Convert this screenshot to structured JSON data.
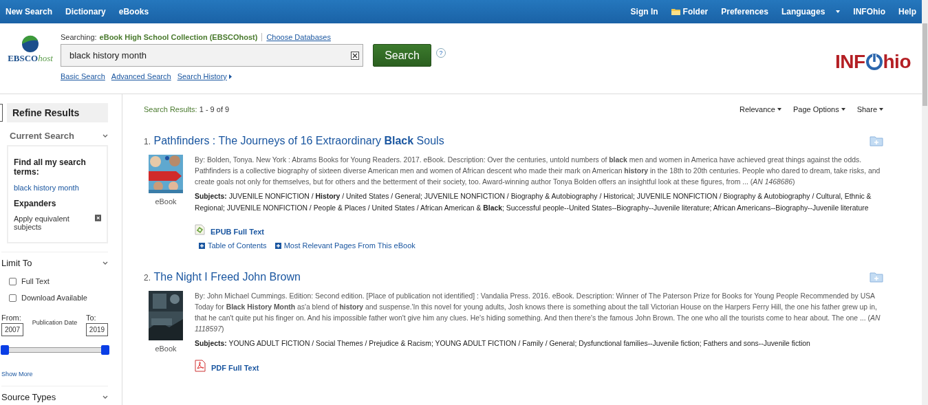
{
  "topbar": {
    "left": [
      "New Search",
      "Dictionary",
      "eBooks"
    ],
    "right": [
      {
        "label": "Sign In",
        "kind": "link"
      },
      {
        "label": "Folder",
        "kind": "folder"
      },
      {
        "label": "Preferences",
        "kind": "link"
      },
      {
        "label": "Languages",
        "kind": "dropdown"
      },
      {
        "label": "INFOhio",
        "kind": "link"
      },
      {
        "label": "Help",
        "kind": "link"
      }
    ]
  },
  "header": {
    "logo": {
      "main": "EBSCO",
      "suffix": "host"
    },
    "searching_label": "Searching:",
    "database": "eBook High School Collection (EBSCOhost)",
    "choose_link": "Choose Databases",
    "query": "black history month",
    "search_button": "Search",
    "help": "?",
    "links": [
      {
        "label": "Basic Search",
        "arrow": false
      },
      {
        "label": "Advanced Search",
        "arrow": false
      },
      {
        "label": "Search History",
        "arrow": true
      }
    ],
    "brand": {
      "left": "INF",
      "right": "hio"
    }
  },
  "sidebar": {
    "title": "Refine Results",
    "current_search": {
      "heading": "Current Search",
      "expanded": true,
      "find_label": "Find all my search terms:",
      "terms": "black history month",
      "expanders_label": "Expanders",
      "expander": "Apply equivalent subjects"
    },
    "limit_to": {
      "heading": "Limit To",
      "expanded": true,
      "options": [
        {
          "label": "Full Text",
          "checked": false
        },
        {
          "label": "Download Available",
          "checked": false
        }
      ],
      "from_label": "From:",
      "to_label": "To:",
      "from": "2007",
      "to": "2019",
      "date_label": "Publication Date",
      "slider": {
        "level": 1
      },
      "show_more": "Show More"
    },
    "source_types": {
      "heading": "Source Types",
      "expanded": true
    }
  },
  "results": {
    "label": "Search Results:",
    "range": "1 - 9 of 9",
    "tools": [
      "Relevance",
      "Page Options",
      "Share"
    ],
    "items": [
      {
        "number": "1.",
        "title": "Pathfinders : The Journeys of 16 Extraordinary **Black** Souls",
        "type": "eBook",
        "description": "By: Bolden, Tonya. New York : Abrams Books for Young Readers. 2017. eBook. Description: Over the centuries, untold numbers of **black** men and women in America have achieved great things against the odds. Pathfinders is a collective biography of sixteen diverse American men and women of African descent who made their mark on American **history** in the 18th to 20th centuries. People who dared to dream, take risks, and create goals not only for themselves, but for others and the betterment of their society, too. Award-winning author Tonya Bolden offers an insightful look at these figures, from ... (*AN 1468686*)",
        "subjects_label": "Subjects:",
        "subjects": "JUVENILE NONFICTION / **History** / United States / General; JUVENILE NONFICTION / Biography & Autobiography / Historical; JUVENILE NONFICTION / Biography & Autobiography / Cultural, Ethnic & Regional; JUVENILE NONFICTION / People & Places / United States / African American & **Black**; Successful people--United States--Biography--Juvenile literature; African Americans--Biography--Juvenile literature",
        "fulltext": {
          "kind": "epub",
          "label": "EPUB Full Text"
        },
        "extras": [
          "Table of Contents",
          "Most Relevant Pages From This eBook"
        ]
      },
      {
        "number": "2.",
        "title": "The Night I Freed John Brown",
        "type": "eBook",
        "description": "By: John Michael Cummings. Edition: Second edition. [Place of publication not identified] : Vandalia Press. 2016. eBook. Description: Winner of The Paterson Prize for Books for Young People Recommended by USA Today for **Black History Month** as'a blend of **history** and suspense.'In this novel for young adults, Josh knows there is something about the tall Victorian House on the Harpers Ferry Hill, the one his father grew up in, that he can't quite put his finger on. And his impossible father won't give him any clues. He's hiding something. And then there's the famous John Brown. The one who all the tourists come to hear about. The one ... (*AN 1118597*)",
        "subjects_label": "Subjects:",
        "subjects": "YOUNG ADULT FICTION / Social Themes / Prejudice & Racism; YOUNG ADULT FICTION / Family / General; Dysfunctional families--Juvenile fiction; Fathers and sons--Juvenile fiction",
        "fulltext": {
          "kind": "pdf",
          "label": "PDF Full Text"
        }
      }
    ]
  }
}
